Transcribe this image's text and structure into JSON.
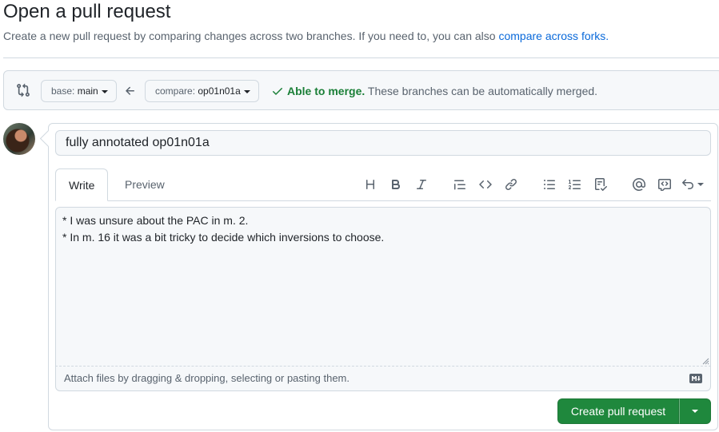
{
  "page": {
    "title": "Open a pull request",
    "subtitle": "Create a new pull request by comparing changes across two branches. If you need to, you can also ",
    "subtitle_link": "compare across forks."
  },
  "range": {
    "base_prefix": "base:",
    "base_branch": "main",
    "compare_prefix": "compare:",
    "compare_branch": "op01n01a",
    "merge_ok": "Able to merge.",
    "merge_text": " These branches can be automatically merged."
  },
  "composer": {
    "title_value": "fully annotated op01n01a",
    "tabs": [
      "Write",
      "Preview"
    ],
    "toolbar": [
      "heading-icon",
      "bold-icon",
      "italic-icon",
      "quote-icon",
      "code-icon",
      "link-icon",
      "unordered-list-icon",
      "ordered-list-icon",
      "task-list-icon",
      "mention-icon",
      "reference-icon",
      "undo-icon"
    ],
    "body": "* I was unsure about the PAC in m. 2.\n* In m. 16 it was a bit tricky to decide which inversions to choose.",
    "attach_hint": "Attach files by dragging & dropping, selecting or pasting them.",
    "create_label": "Create pull request"
  },
  "colors": {
    "primary_button": "#1f883d",
    "link": "#0969da",
    "success": "#1a7f37"
  }
}
